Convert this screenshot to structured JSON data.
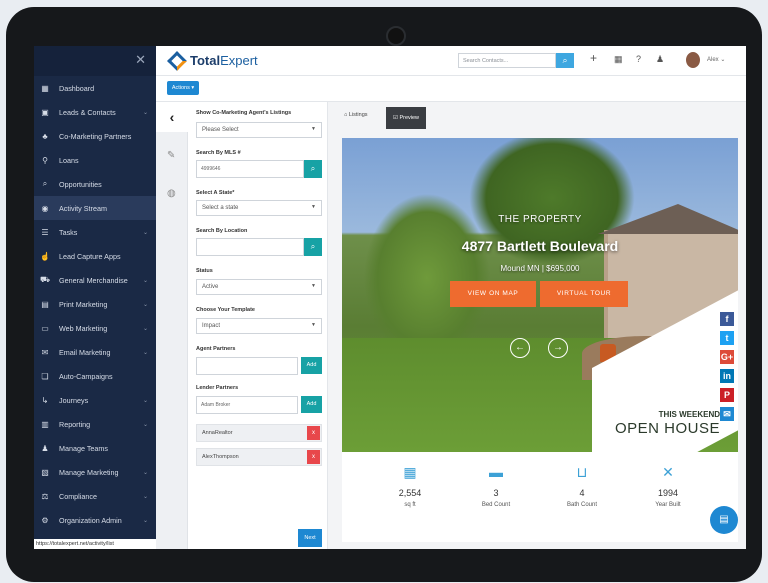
{
  "sidebar": {
    "close": "✕",
    "items": [
      {
        "label": "Dashboard",
        "icon": "dashboard-icon",
        "glyph": "▦",
        "chevron": false
      },
      {
        "label": "Leads & Contacts",
        "icon": "contacts-icon",
        "glyph": "▣",
        "chevron": true
      },
      {
        "label": "Co-Marketing Partners",
        "icon": "partners-icon",
        "glyph": "♣",
        "chevron": false
      },
      {
        "label": "Loans",
        "icon": "loans-icon",
        "glyph": "⚲",
        "chevron": false
      },
      {
        "label": "Opportunities",
        "icon": "opportunities-icon",
        "glyph": "⌕",
        "chevron": false
      },
      {
        "label": "Activity Stream",
        "icon": "activity-icon",
        "glyph": "◉",
        "chevron": false,
        "active": true
      },
      {
        "label": "Tasks",
        "icon": "tasks-icon",
        "glyph": "☰",
        "chevron": true
      },
      {
        "label": "Lead Capture Apps",
        "icon": "lead-capture-icon",
        "glyph": "☝",
        "chevron": false
      },
      {
        "label": "General Merchandise",
        "icon": "cart-icon",
        "glyph": "⛟",
        "chevron": true
      },
      {
        "label": "Print Marketing",
        "icon": "print-icon",
        "glyph": "▤",
        "chevron": true
      },
      {
        "label": "Web Marketing",
        "icon": "web-icon",
        "glyph": "▭",
        "chevron": true
      },
      {
        "label": "Email Marketing",
        "icon": "email-icon",
        "glyph": "✉",
        "chevron": true
      },
      {
        "label": "Auto-Campaigns",
        "icon": "campaigns-icon",
        "glyph": "❏",
        "chevron": false
      },
      {
        "label": "Journeys",
        "icon": "journeys-icon",
        "glyph": "↳",
        "chevron": true
      },
      {
        "label": "Reporting",
        "icon": "reporting-icon",
        "glyph": "▥",
        "chevron": true
      },
      {
        "label": "Manage Teams",
        "icon": "teams-icon",
        "glyph": "♟",
        "chevron": false
      },
      {
        "label": "Manage Marketing",
        "icon": "manage-marketing-icon",
        "glyph": "▧",
        "chevron": true
      },
      {
        "label": "Compliance",
        "icon": "compliance-icon",
        "glyph": "⚖",
        "chevron": true
      },
      {
        "label": "Organization Admin",
        "icon": "admin-icon",
        "glyph": "⚙",
        "chevron": true
      }
    ],
    "status_url": "https://totalexpert.net/activity/list"
  },
  "header": {
    "logo_bold": "Total",
    "logo_rest": "Expert",
    "search_placeholder": "Search Contacts...",
    "user_name": "Alex ⌄"
  },
  "actions_label": "Actions ▾",
  "form": {
    "show_agents_label": "Show Co-Marketing Agent's Listings",
    "show_agents_value": "Please Select",
    "mls_label": "Search By MLS #",
    "mls_value": "4999646",
    "state_label": "Select A State*",
    "state_value": "Select a state",
    "location_label": "Search By Location",
    "location_value": "",
    "status_label": "Status",
    "status_value": "Active",
    "template_label": "Choose Your Template",
    "template_value": "Impact",
    "agent_partners_label": "Agent Partners",
    "agent_partners_value": "",
    "lender_partners_label": "Lender Partners",
    "lender_partners_value": "Adam Broker",
    "add_label": "Add",
    "partners": [
      "AnnaRealtor",
      "AlexThompson"
    ],
    "remove_label": "x",
    "next_label": "Next"
  },
  "preview": {
    "tab_listings": "⌂ Listings",
    "tab_preview": "☑ Preview",
    "eyebrow": "THE PROPERTY",
    "address": "4877 Bartlett Boulevard",
    "location_price": "Mound MN | $695,000",
    "view_map": "VIEW ON MAP",
    "virtual_tour": "VIRTUAL TOUR",
    "this_weekend": "THIS WEEKEND",
    "open_house": "OPEN HOUSE",
    "stats": [
      {
        "value": "2,554",
        "label": "sq ft",
        "icon": "floorplan-icon",
        "glyph": "▦"
      },
      {
        "value": "3",
        "label": "Bed Count",
        "icon": "bed-icon",
        "glyph": "▬"
      },
      {
        "value": "4",
        "label": "Bath Count",
        "icon": "bath-icon",
        "glyph": "⊔"
      },
      {
        "value": "1994",
        "label": "Year Built",
        "icon": "tools-icon",
        "glyph": "✕"
      }
    ]
  },
  "share": [
    {
      "icon": "facebook-icon",
      "glyph": "f",
      "color": "#3b5998"
    },
    {
      "icon": "twitter-icon",
      "glyph": "t",
      "color": "#1da1f2"
    },
    {
      "icon": "google-plus-icon",
      "glyph": "G+",
      "color": "#dd4b39"
    },
    {
      "icon": "linkedin-icon",
      "glyph": "in",
      "color": "#0077b5"
    },
    {
      "icon": "pinterest-icon",
      "glyph": "P",
      "color": "#cb2027"
    },
    {
      "icon": "email-share-icon",
      "glyph": "✉",
      "color": "#1e88d2"
    }
  ]
}
